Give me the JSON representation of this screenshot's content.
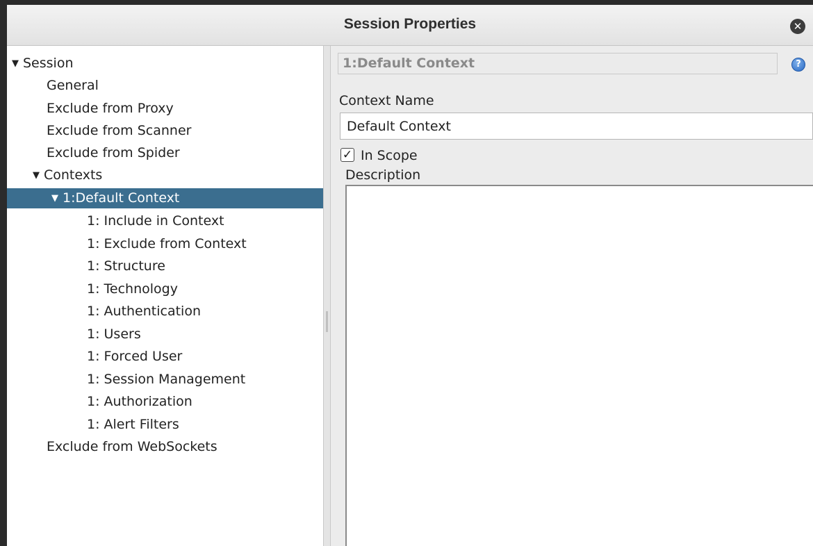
{
  "window": {
    "title": "Session Properties",
    "close_icon": "close-icon"
  },
  "tree": {
    "items": [
      {
        "label": "Session",
        "expanded": true
      },
      {
        "label": "General"
      },
      {
        "label": "Exclude from Proxy"
      },
      {
        "label": "Exclude from Scanner"
      },
      {
        "label": "Exclude from Spider"
      },
      {
        "label": "Contexts",
        "expanded": true
      },
      {
        "label": "1:Default Context",
        "expanded": true,
        "selected": true
      },
      {
        "label": "1: Include in Context"
      },
      {
        "label": "1: Exclude from Context"
      },
      {
        "label": "1: Structure"
      },
      {
        "label": "1: Technology"
      },
      {
        "label": "1: Authentication"
      },
      {
        "label": "1: Users"
      },
      {
        "label": "1: Forced User"
      },
      {
        "label": "1: Session Management"
      },
      {
        "label": "1: Authorization"
      },
      {
        "label": "1: Alert Filters"
      },
      {
        "label": "Exclude from WebSockets"
      }
    ]
  },
  "panel": {
    "header": "1:Default Context",
    "help_icon": "help-icon",
    "context_name_label": "Context Name",
    "context_name_value": "Default Context",
    "in_scope_label": "In Scope",
    "in_scope_checked": true,
    "description_label": "Description",
    "description_value": ""
  },
  "colors": {
    "selection": "#3b6e8f",
    "window_bg": "#ececec"
  }
}
